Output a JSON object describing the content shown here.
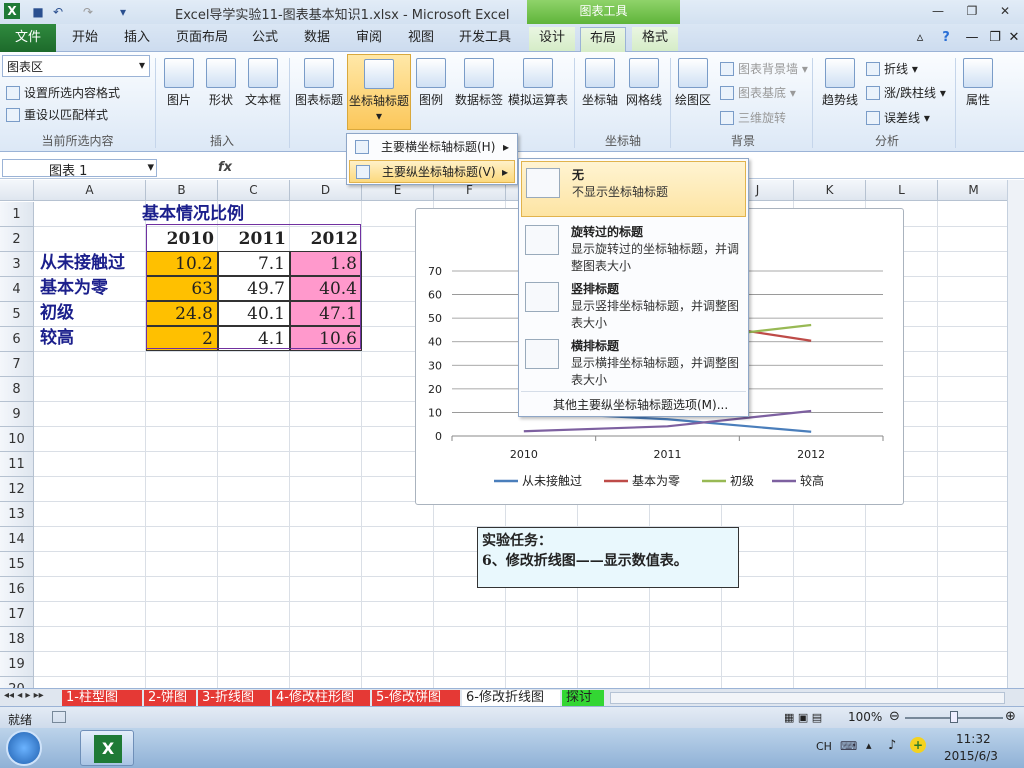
{
  "window": {
    "title": "Excel导学实验11-图表基本知识1.xlsx - Microsoft Excel",
    "context_header": "图表工具"
  },
  "tabs": [
    "文件",
    "开始",
    "插入",
    "页面布局",
    "公式",
    "数据",
    "审阅",
    "视图",
    "开发工具",
    "设计",
    "布局",
    "格式"
  ],
  "ribbon": {
    "selection_box": "图表区",
    "format_selection": "设置所选内容格式",
    "reset_style": "重设以匹配样式",
    "current_selection_label": "当前所选内容",
    "insert": {
      "picture": "图片",
      "shapes": "形状",
      "textbox": "文本框",
      "label": "插入"
    },
    "labels": {
      "chart_title": "图表标题",
      "axis_titles": "坐标轴标题",
      "legend": "图例",
      "data_labels": "数据标签",
      "data_table": "模拟运算表"
    },
    "axes": {
      "axes": "坐标轴",
      "gridlines": "网格线",
      "label": "坐标轴"
    },
    "background": {
      "plot_area": "绘图区",
      "chart_wall": "图表背景墙",
      "chart_floor": "图表基底",
      "rotation": "三维旋转",
      "label": "背景"
    },
    "analysis": {
      "trendline": "趋势线",
      "lines": "折线",
      "updown": "涨/跌柱线",
      "error": "误差线",
      "label": "分析"
    },
    "properties": "属性"
  },
  "formula_bar": {
    "name": "图表 1",
    "fx": "fx"
  },
  "columns": [
    "A",
    "B",
    "C",
    "D",
    "E",
    "F",
    "G",
    "H",
    "I",
    "J",
    "K",
    "L",
    "M"
  ],
  "rows": [
    "1",
    "2",
    "3",
    "4",
    "5",
    "6",
    "7",
    "8",
    "9",
    "10",
    "11",
    "12",
    "13",
    "14",
    "15",
    "16",
    "17",
    "18",
    "19",
    "20"
  ],
  "table": {
    "title": "基本情况比例",
    "headers": [
      "2010",
      "2011",
      "2012"
    ],
    "rows": [
      {
        "label": "从未接触过",
        "values": [
          "10.2",
          "7.1",
          "1.8"
        ]
      },
      {
        "label": "基本为零",
        "values": [
          "63",
          "49.7",
          "40.4"
        ]
      },
      {
        "label": "初级",
        "values": [
          "24.8",
          "40.1",
          "47.1"
        ]
      },
      {
        "label": "较高",
        "values": [
          "2",
          "4.1",
          "10.6"
        ]
      }
    ]
  },
  "chart_data": {
    "type": "line",
    "categories": [
      "2010",
      "2011",
      "2012"
    ],
    "ylim": [
      0,
      70
    ],
    "yticks": [
      "0",
      "10",
      "20",
      "30",
      "40",
      "50",
      "60",
      "70"
    ],
    "series": [
      {
        "name": "从未接触过",
        "color": "#4a7ebb",
        "values": [
          10.2,
          7.1,
          1.8
        ]
      },
      {
        "name": "基本为零",
        "color": "#be4b48",
        "values": [
          63,
          49.7,
          40.4
        ]
      },
      {
        "name": "初级",
        "color": "#98b954",
        "values": [
          24.8,
          40.1,
          47.1
        ]
      },
      {
        "name": "较高",
        "color": "#7d60a0",
        "values": [
          2,
          4.1,
          10.6
        ]
      }
    ],
    "legend": "bottom",
    "grid": true
  },
  "menu1": {
    "items": [
      "主要横坐标轴标题(H)",
      "主要纵坐标轴标题(V)"
    ]
  },
  "menu2": {
    "items": [
      {
        "title": "无",
        "desc": "不显示坐标轴标题"
      },
      {
        "title": "旋转过的标题",
        "desc": "显示旋转过的坐标轴标题，并调整图表大小"
      },
      {
        "title": "竖排标题",
        "desc": "显示竖排坐标轴标题，并调整图表大小"
      },
      {
        "title": "横排标题",
        "desc": "显示横排坐标轴标题，并调整图表大小"
      }
    ],
    "more": "其他主要纵坐标轴标题选项(M)..."
  },
  "note": {
    "line1": "实验任务：",
    "line2": "6、修改折线图——显示数值表。"
  },
  "sheets": [
    "1-柱型图",
    "2-饼图",
    "3-折线图",
    "4-修改柱形图",
    "5-修改饼图",
    "6-修改折线图",
    "探讨"
  ],
  "status": {
    "ready": "就绪",
    "zoom": "100%"
  },
  "taskbar": {
    "lang": "CH",
    "time": "11:32",
    "date": "2015/6/3"
  }
}
